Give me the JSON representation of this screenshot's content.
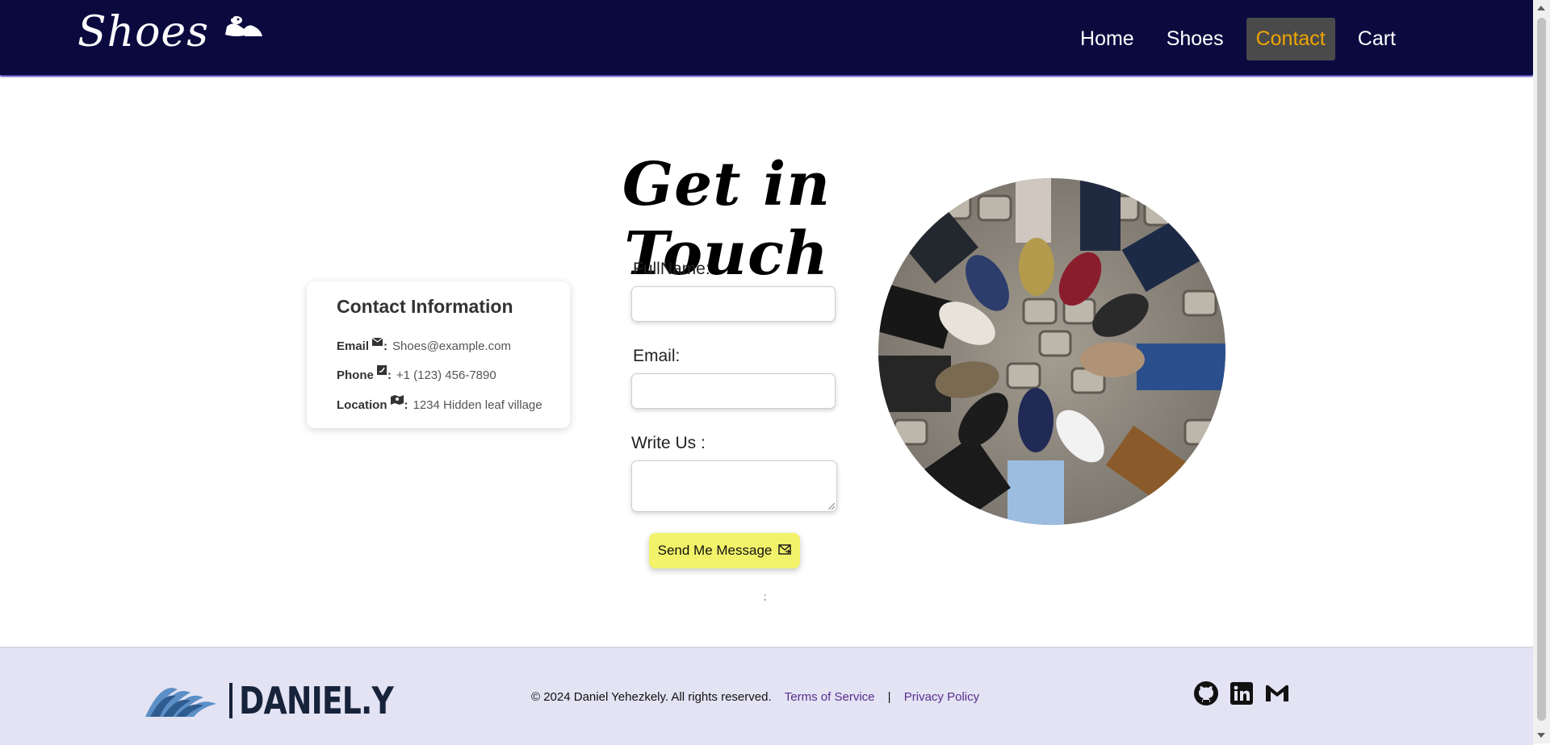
{
  "header": {
    "brand": "Shoes",
    "nav": [
      {
        "label": "Home",
        "active": false
      },
      {
        "label": "Shoes",
        "active": false
      },
      {
        "label": "Contact",
        "active": true
      },
      {
        "label": "Cart",
        "active": false
      }
    ]
  },
  "page": {
    "title": "Get in Touch"
  },
  "contact_card": {
    "title": "Contact Information",
    "email_label": "Email",
    "email_value": "Shoes@example.com",
    "phone_label": "Phone",
    "phone_value": "+1 (123) 456-7890",
    "location_label": "Location",
    "location_value": "1234 Hidden leaf village",
    "colon": ":"
  },
  "form": {
    "fullname_label": "FullName:",
    "email_label": "Email:",
    "message_label": "Write Us :",
    "fullname_value": "",
    "email_value": "",
    "message_value": "",
    "submit_label": "Send Me Message",
    "stray_text": ";"
  },
  "footer": {
    "logo_text": "DANIEL.Y",
    "copyright": "© 2024 Daniel Yehezkely. All rights reserved.",
    "terms": "Terms of Service",
    "separator": "|",
    "privacy": "Privacy Policy",
    "social": [
      "github-icon",
      "linkedin-icon",
      "gmail-icon"
    ]
  },
  "colors": {
    "header_bg": "#0b0a3f",
    "nav_active_text": "#f0a500",
    "nav_active_bg": "#4a4a4a",
    "submit_bg": "#f3f36b",
    "footer_bg": "#e3e3f4",
    "footer_link": "#5a2d8c"
  }
}
